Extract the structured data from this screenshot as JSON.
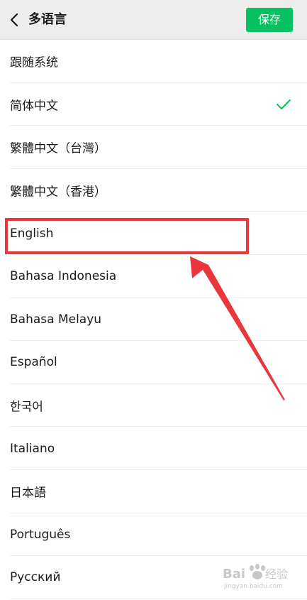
{
  "header": {
    "back_icon": "chevron-left-icon",
    "title": "多语言",
    "save_label": "保存",
    "save_color": "#07c160"
  },
  "languages": [
    {
      "label": "跟随系统",
      "selected": false
    },
    {
      "label": "简体中文",
      "selected": true
    },
    {
      "label": "繁體中文（台灣）",
      "selected": false
    },
    {
      "label": "繁體中文（香港）",
      "selected": false
    },
    {
      "label": "English",
      "selected": false
    },
    {
      "label": "Bahasa Indonesia",
      "selected": false
    },
    {
      "label": "Bahasa Melayu",
      "selected": false
    },
    {
      "label": "Español",
      "selected": false
    },
    {
      "label": "한국어",
      "selected": false
    },
    {
      "label": "Italiano",
      "selected": false
    },
    {
      "label": "日本語",
      "selected": false
    },
    {
      "label": "Português",
      "selected": false
    },
    {
      "label": "Русский",
      "selected": false
    }
  ],
  "check_color": "#07c160",
  "annotation": {
    "highlighted_item": "English",
    "color": "#e8383d"
  },
  "watermark": {
    "logo": "Bai du 经验",
    "url": "jingyan.baidu.com"
  }
}
